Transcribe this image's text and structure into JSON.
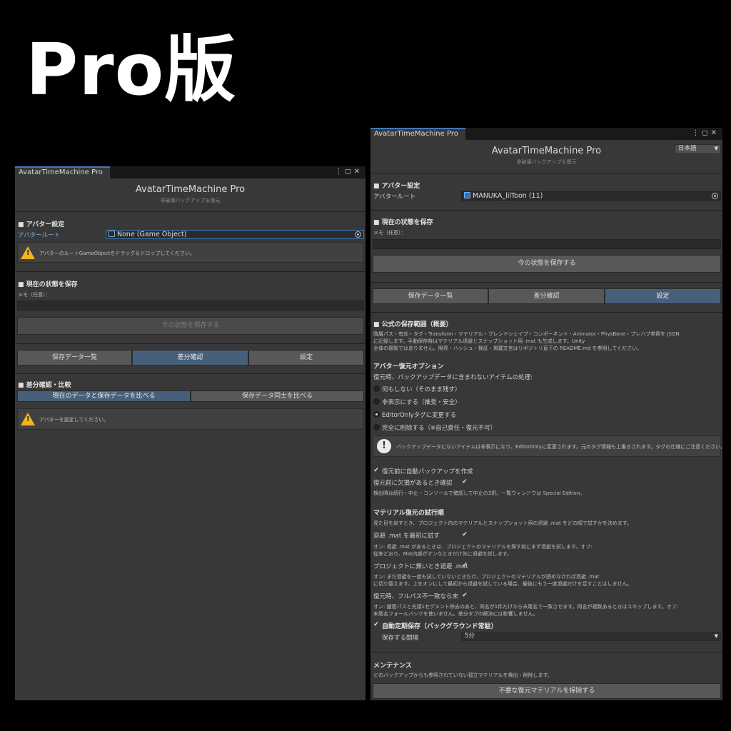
{
  "hero_title": "Pro版",
  "left": {
    "tab": "AvatarTimeMachine Pro",
    "title": "AvatarTimeMachine Pro",
    "subtitle": "非破壊バックアップ＆復元",
    "avatar_section": "■ アバター設定",
    "avatar_root_label": "アバタールート",
    "avatar_root_value": "None (Game Object)",
    "avatar_warning": "アバターのルートGameObjectをドラッグ＆ドロップしてください。",
    "save_section": "■ 現在の状態を保存",
    "memo_label": "メモ（任意）：",
    "memo_value": "",
    "save_button": "今の状態を保存する",
    "tabs": [
      "保存データ一覧",
      "差分確認",
      "設定"
    ],
    "selected_tab": "差分確認",
    "diff_section": "■ 差分確認・比較",
    "compare_current": "現在のデータと保存データを比べる",
    "compare_saved": "保存データ同士を比べる",
    "diff_warning": "アバターを設定してください。"
  },
  "right": {
    "tab": "AvatarTimeMachine Pro",
    "title": "AvatarTimeMachine Pro",
    "subtitle": "非破壊バックアップ＆復元",
    "language": "日本語",
    "avatar_section": "■ アバター設定",
    "avatar_root_label": "アバタールート",
    "avatar_root_value": "MANUKA_lilToon (11)",
    "save_section": "■ 現在の状態を保存",
    "memo_label": "メモ（任意）：",
    "memo_value": "",
    "save_button": "今の状態を保存する",
    "tabs": [
      "保存データ一覧",
      "差分確認",
      "設定"
    ],
    "selected_tab": "設定",
    "scope_section": "■ 公式の保存範囲（概要）",
    "scope_line1": "階層パス・有効・タグ・Transform・マテリアル・ブレンドシェイプ・コンポーネント・Animator・PhysBone・プレハブ参照を JSON",
    "scope_line2": "に記録します。手動保存時はマテリアル退避とスナップショット用 .mat も生成します。Unity",
    "scope_line3": "全体の複製ではありません。限界・ハッシュ・検証・掲載文言はリポジトリ直下の README.md を参照してください。",
    "restore_section": "アバター復元オプション",
    "restore_desc": "復元時、バックアップデータに含まれないアイテムの処理:",
    "radio_options": [
      "何もしない（そのまま残す）",
      "非表示にする（推奨・安全）",
      "EditorOnlyタグに変更する",
      "完全に削除する（※自己責任・復元不可）"
    ],
    "radio_selected": "EditorOnlyタグに変更する",
    "info_text": "バックアップデータにないアイテムは非表示になり、EditorOnlyに変更されます。元のタグ情報も上書きされます。タグの仕様にご注意ください。",
    "auto_backup_label": "復元前に自動バックアップを作成",
    "auto_backup_checked": true,
    "missing_check_label": "復元前に欠損があるとき確認",
    "missing_check_checked": true,
    "missing_check_desc": "検出時は続行・中止・コンソールで確認して中止の3択。一覧ウィンドウは Special Edition。",
    "material_section": "マテリアル復元の試行順",
    "material_desc": "見た目を戻すとき、プロジェクト内のマテリアルとスナップショット用の退避 .mat をどの順で試すかを決めます。",
    "opt1_label": "退避 .mat を最初に試す",
    "opt1_checked": true,
    "opt1_desc1": "オン: 退避 .mat があるときは、プロジェクトのマテリアルを探す前にまず退避を試します。オフ:",
    "opt1_desc2": "従来どおり、Mat内部がオンなときだけ先に退避を試します。",
    "opt2_label": "プロジェクトに無いとき退避 .mat",
    "opt2_checked": true,
    "opt2_desc1": "オン: まだ退避を一度も試していないときだけ、プロジェクトのマテリアルが読めなければ退避 .mat",
    "opt2_desc2": "に切り替えます。上をオンにして最初から退避を試している場合、最後にもう一度退避だけを足すことはしません。",
    "opt3_label": "復元時、フルパス不一致なら末",
    "opt3_checked": true,
    "opt3_desc1": "オン: 厳密パスと先頭1セグメント除去のあと、同名が1件だけなら末尾名で一致させます。同名が複数あるときはスキップします。オフ:",
    "opt3_desc2": "末尾名フォールバックを使いません。差分タブの解決には影響しません。",
    "auto_save_section": "自動定期保存（バックグラウンド常駐）",
    "auto_save_checked": true,
    "interval_label": "保存する間隔",
    "interval_value": "5分",
    "maintenance_section": "メンテナンス",
    "maintenance_desc": "どのバックアップからも参照されていない孤立マテリアルを検出・削除します。",
    "cleanup_button": "不要な復元マテリアルを掃除する"
  }
}
